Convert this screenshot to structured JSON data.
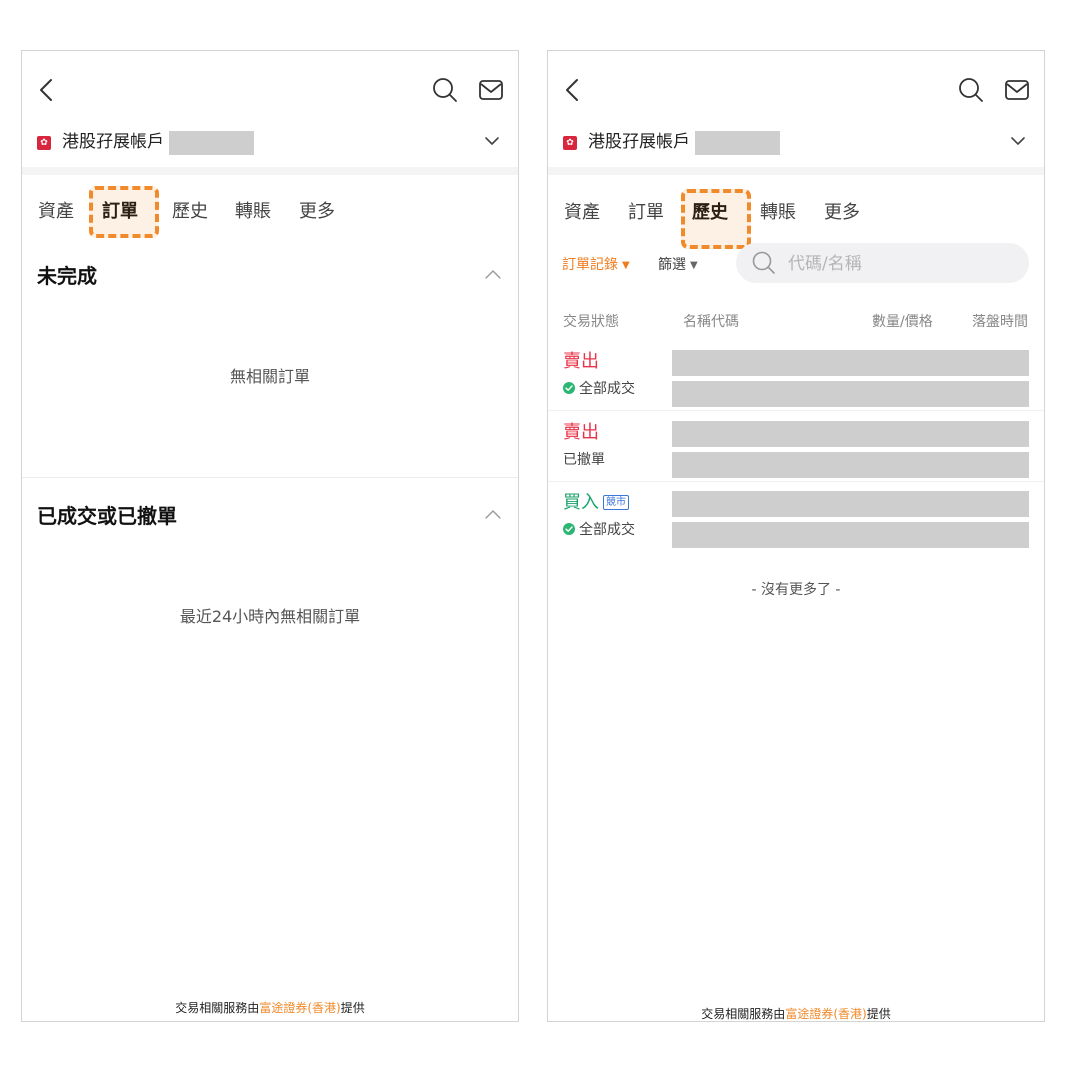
{
  "left": {
    "account": {
      "name": "港股孖展帳戶"
    },
    "tabs": [
      "資產",
      "訂單",
      "歷史",
      "轉賬",
      "更多"
    ],
    "active_tab": "訂單",
    "sections": {
      "pending": {
        "title": "未完成",
        "empty": "無相關訂單"
      },
      "done": {
        "title": "已成交或已撤單",
        "empty": "最近24小時內無相關訂單"
      }
    },
    "footer": {
      "prefix": "交易相關服務由",
      "brand": "富途證券(香港)",
      "suffix": "提供"
    }
  },
  "right": {
    "account": {
      "name": "港股孖展帳戶"
    },
    "tabs": [
      "資產",
      "訂單",
      "歷史",
      "轉賬",
      "更多"
    ],
    "active_tab": "歷史",
    "filters": {
      "order_record": "訂單記錄",
      "screen": "篩選"
    },
    "search": {
      "placeholder": "代碼/名稱"
    },
    "columns": {
      "status": "交易狀態",
      "name_code": "名稱代碼",
      "qty_price": "數量/價格",
      "time": "落盤時間"
    },
    "orders": [
      {
        "side": "賣出",
        "side_type": "sell",
        "status": "全部成交",
        "filled": true
      },
      {
        "side": "賣出",
        "side_type": "sell",
        "status": "已撤單",
        "filled": false
      },
      {
        "side": "買入",
        "side_type": "buy",
        "badge": "競市",
        "status": "全部成交",
        "filled": true
      }
    ],
    "no_more": "- 沒有更多了 -",
    "footer": {
      "prefix": "交易相關服務由",
      "brand": "富途證券(香港)",
      "suffix": "提供"
    }
  },
  "colors": {
    "accent": "#f08a2a",
    "sell": "#e8344a",
    "buy": "#1aa36b",
    "mask": "#cecece",
    "flag": "#d7263d"
  }
}
